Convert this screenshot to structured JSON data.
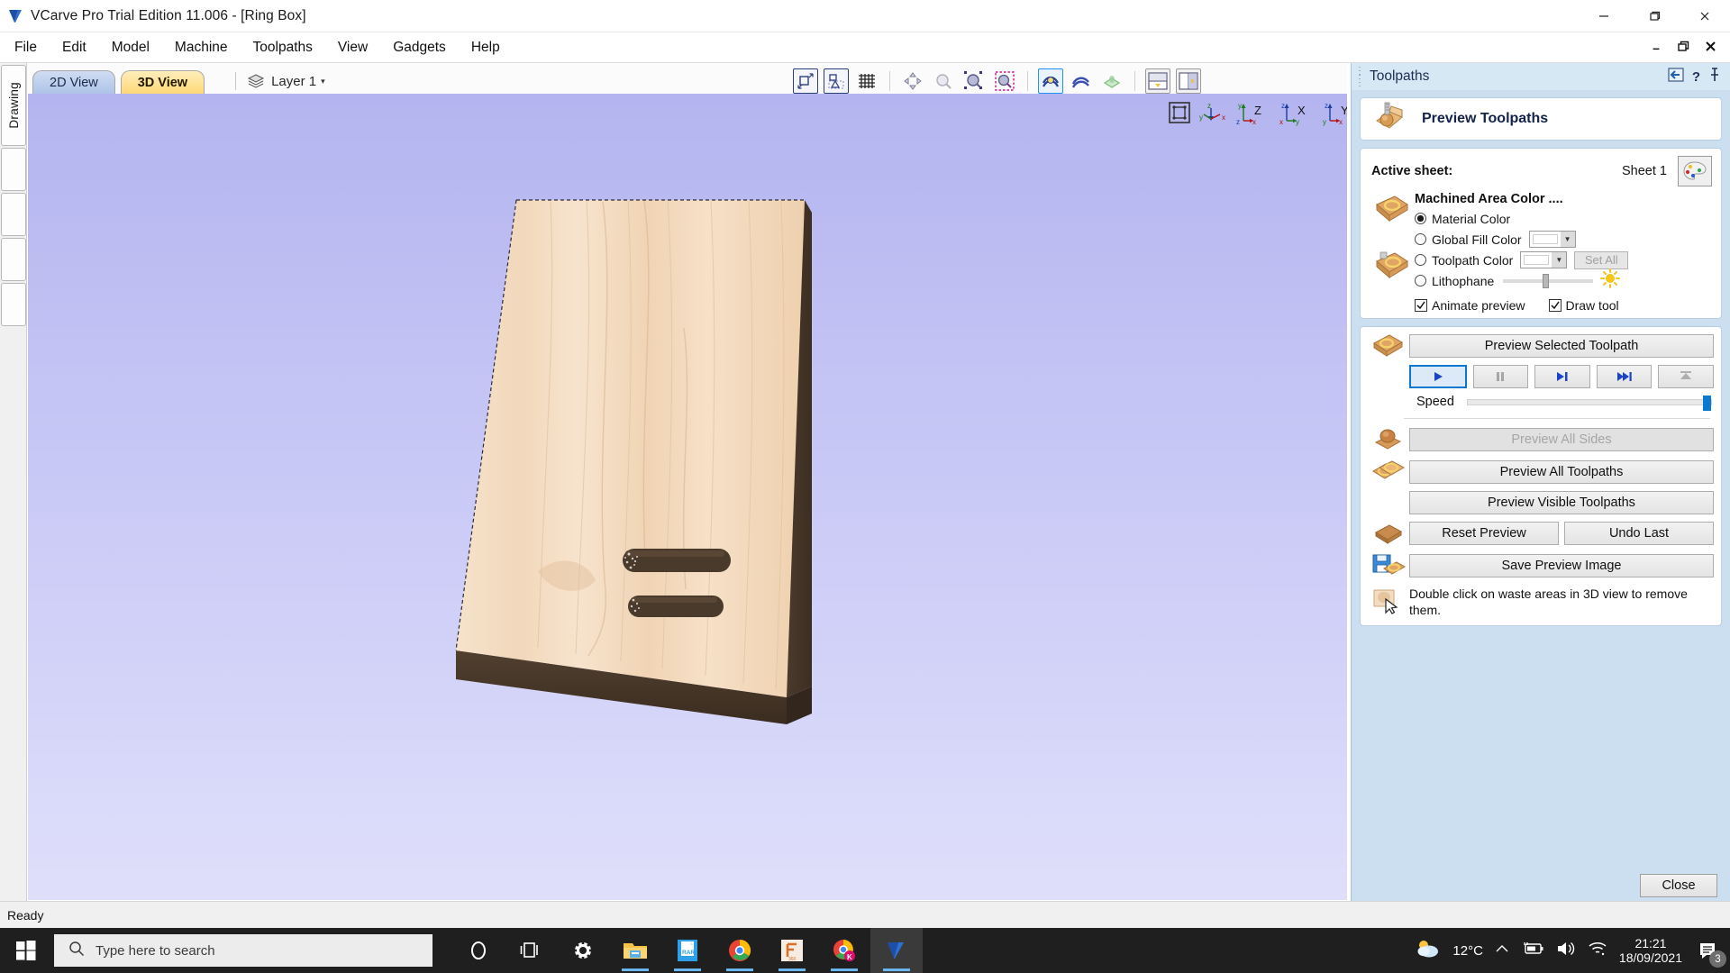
{
  "titlebar": {
    "app_title": "VCarve Pro Trial Edition 11.006 - [Ring Box]",
    "minimize": "—",
    "maximize": "❐",
    "close": "✕",
    "logo_icon": "vcarve-logo-icon"
  },
  "menubar": {
    "items": [
      "File",
      "Edit",
      "Model",
      "Machine",
      "Toolpaths",
      "View",
      "Gadgets",
      "Help"
    ],
    "mdi_minimize": "–",
    "mdi_restore": "❐",
    "mdi_close": "✕"
  },
  "sidestrip": {
    "active_tab": "Drawing",
    "blank_tabs": [
      "",
      "",
      "",
      ""
    ]
  },
  "viewtabs": {
    "tab_2d": "2D View",
    "tab_3d": "3D View",
    "layer_label": "Layer 1",
    "layer_caret": "▾",
    "layer_icon": "layers-icon"
  },
  "toolbar": {
    "icons": [
      "scale-to-fit-icon",
      "snap-to-objects-icon",
      "grid-icon",
      "pan-view-icon",
      "zoom-to-selection-icon",
      "zoom-to-drawing-icon",
      "zoom-to-selected-icon",
      "twist-toolpath-icon",
      "toggle-toolpath-icon",
      "model-preview-icon",
      "split-horizontal-icon",
      "split-vertical-icon"
    ]
  },
  "viewport": {
    "axis_widgets": [
      "fit-view-icon",
      "iso-view-icon",
      "z-view-icon",
      "x-view-icon",
      "y-view-icon"
    ],
    "model_name": "ring-box-board"
  },
  "dock": {
    "title": "Toolpaths",
    "collapse_icon": "collapse-panel-icon",
    "help_icon": "help-icon",
    "pin_icon": "pin-icon",
    "header": {
      "label": "Preview Toolpaths",
      "icon": "preview-toolpaths-icon"
    },
    "sheet": {
      "label": "Active sheet:",
      "value": "Sheet 1",
      "palette_icon": "color-palette-icon"
    },
    "machined_area": {
      "title": "Machined Area Color ....",
      "icon": "machined-area-icon",
      "options": [
        {
          "label": "Material Color",
          "selected": true
        },
        {
          "label": "Global Fill Color",
          "selected": false
        },
        {
          "label": "Toolpath Color",
          "selected": false
        },
        {
          "label": "Lithophane",
          "selected": false
        }
      ],
      "set_all_label": "Set All",
      "set_all_enabled": false,
      "dropdown_caret": "▼",
      "lithophane_slider_percent": 44,
      "sun_icon": "brightness-sun-icon",
      "animate_preview": {
        "label": "Animate preview",
        "checked": true
      },
      "draw_tool": {
        "label": "Draw tool",
        "checked": true
      }
    },
    "preview": {
      "selected_toolpath_label": "Preview Selected Toolpath",
      "selected_icon": "preview-selected-icon",
      "transport": [
        {
          "name": "play",
          "icon": "play-icon",
          "state": "focused"
        },
        {
          "name": "pause",
          "icon": "pause-icon",
          "state": "disabled"
        },
        {
          "name": "step",
          "icon": "step-forward-icon",
          "state": "enabled"
        },
        {
          "name": "fast-forward",
          "icon": "fast-forward-icon",
          "state": "enabled"
        },
        {
          "name": "finish",
          "icon": "finish-icon",
          "state": "disabled"
        }
      ],
      "speed_label": "Speed",
      "speed_percent": 100,
      "all_sides": {
        "label": "Preview All Sides",
        "enabled": false,
        "icon": "preview-all-sides-icon"
      },
      "all_toolpaths": {
        "label": "Preview All Toolpaths",
        "enabled": true,
        "icon": "preview-all-toolpaths-icon"
      },
      "visible_toolpaths": {
        "label": "Preview Visible Toolpaths",
        "enabled": true
      },
      "reset_preview": {
        "label": "Reset Preview",
        "icon": "reset-preview-icon"
      },
      "undo_last": {
        "label": "Undo Last"
      },
      "save_preview_image": {
        "label": "Save Preview Image",
        "icon": "save-preview-image-icon"
      },
      "note_icon": "double-click-hint-icon",
      "note_text": "Double click on waste areas in 3D view to remove them."
    },
    "close_label": "Close"
  },
  "statusbar": {
    "message": "Ready"
  },
  "taskbar": {
    "start_icon": "windows-start-icon",
    "search_placeholder": "Type here to search",
    "search_icon": "search-icon",
    "icons": [
      "cortana-icon",
      "task-view-icon",
      "settings-gear-icon",
      "file-explorer-icon",
      "winrar-icon",
      "chrome-icon",
      "fusion360-icon",
      "chrome-kaspersky-icon",
      "vcarve-icon"
    ],
    "tray": {
      "weather_icon": "weather-partly-cloudy-icon",
      "temperature": "12°C",
      "chevron_icon": "chevron-up-icon",
      "battery_icon": "battery-charging-icon",
      "volume_icon": "volume-icon",
      "wifi_icon": "wifi-icon",
      "time": "21:21",
      "date": "18/09/2021",
      "notification_icon": "notifications-icon",
      "notification_count": "3"
    }
  },
  "colors": {
    "viewport_top": "#b4b4f0",
    "viewport_bottom": "#dfdffb",
    "wood_light": "#f3ddc2",
    "wood_dark": "#4a3a2c",
    "accent_blue": "#0b78d0",
    "dock_bg": "#ccdff0",
    "tab_3d": "#ffd978",
    "tab_2d": "#aec4e8"
  }
}
